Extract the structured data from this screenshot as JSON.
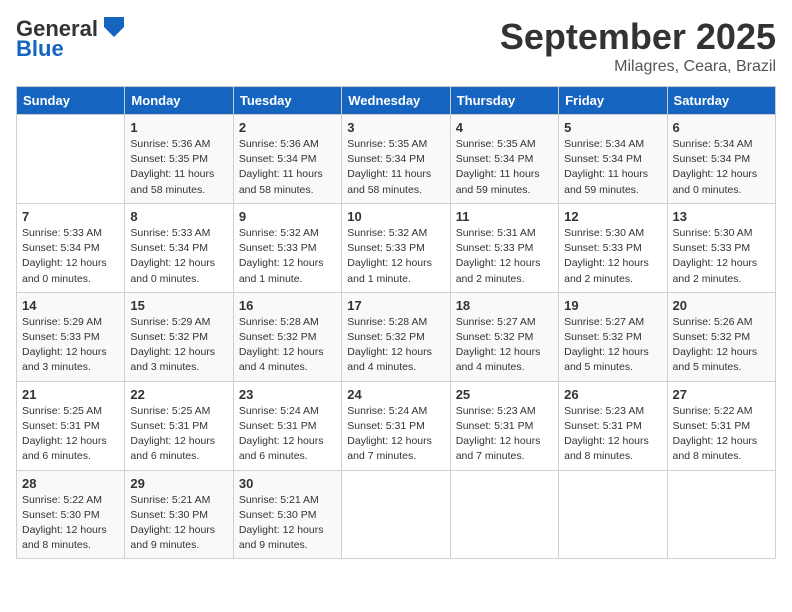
{
  "header": {
    "logo_general": "General",
    "logo_blue": "Blue",
    "month_year": "September 2025",
    "location": "Milagres, Ceara, Brazil"
  },
  "calendar": {
    "days_of_week": [
      "Sunday",
      "Monday",
      "Tuesday",
      "Wednesday",
      "Thursday",
      "Friday",
      "Saturday"
    ],
    "weeks": [
      [
        {
          "day": "",
          "info": ""
        },
        {
          "day": "1",
          "info": "Sunrise: 5:36 AM\nSunset: 5:35 PM\nDaylight: 11 hours\nand 58 minutes."
        },
        {
          "day": "2",
          "info": "Sunrise: 5:36 AM\nSunset: 5:34 PM\nDaylight: 11 hours\nand 58 minutes."
        },
        {
          "day": "3",
          "info": "Sunrise: 5:35 AM\nSunset: 5:34 PM\nDaylight: 11 hours\nand 58 minutes."
        },
        {
          "day": "4",
          "info": "Sunrise: 5:35 AM\nSunset: 5:34 PM\nDaylight: 11 hours\nand 59 minutes."
        },
        {
          "day": "5",
          "info": "Sunrise: 5:34 AM\nSunset: 5:34 PM\nDaylight: 11 hours\nand 59 minutes."
        },
        {
          "day": "6",
          "info": "Sunrise: 5:34 AM\nSunset: 5:34 PM\nDaylight: 12 hours\nand 0 minutes."
        }
      ],
      [
        {
          "day": "7",
          "info": "Sunrise: 5:33 AM\nSunset: 5:34 PM\nDaylight: 12 hours\nand 0 minutes."
        },
        {
          "day": "8",
          "info": "Sunrise: 5:33 AM\nSunset: 5:34 PM\nDaylight: 12 hours\nand 0 minutes."
        },
        {
          "day": "9",
          "info": "Sunrise: 5:32 AM\nSunset: 5:33 PM\nDaylight: 12 hours\nand 1 minute."
        },
        {
          "day": "10",
          "info": "Sunrise: 5:32 AM\nSunset: 5:33 PM\nDaylight: 12 hours\nand 1 minute."
        },
        {
          "day": "11",
          "info": "Sunrise: 5:31 AM\nSunset: 5:33 PM\nDaylight: 12 hours\nand 2 minutes."
        },
        {
          "day": "12",
          "info": "Sunrise: 5:30 AM\nSunset: 5:33 PM\nDaylight: 12 hours\nand 2 minutes."
        },
        {
          "day": "13",
          "info": "Sunrise: 5:30 AM\nSunset: 5:33 PM\nDaylight: 12 hours\nand 2 minutes."
        }
      ],
      [
        {
          "day": "14",
          "info": "Sunrise: 5:29 AM\nSunset: 5:33 PM\nDaylight: 12 hours\nand 3 minutes."
        },
        {
          "day": "15",
          "info": "Sunrise: 5:29 AM\nSunset: 5:32 PM\nDaylight: 12 hours\nand 3 minutes."
        },
        {
          "day": "16",
          "info": "Sunrise: 5:28 AM\nSunset: 5:32 PM\nDaylight: 12 hours\nand 4 minutes."
        },
        {
          "day": "17",
          "info": "Sunrise: 5:28 AM\nSunset: 5:32 PM\nDaylight: 12 hours\nand 4 minutes."
        },
        {
          "day": "18",
          "info": "Sunrise: 5:27 AM\nSunset: 5:32 PM\nDaylight: 12 hours\nand 4 minutes."
        },
        {
          "day": "19",
          "info": "Sunrise: 5:27 AM\nSunset: 5:32 PM\nDaylight: 12 hours\nand 5 minutes."
        },
        {
          "day": "20",
          "info": "Sunrise: 5:26 AM\nSunset: 5:32 PM\nDaylight: 12 hours\nand 5 minutes."
        }
      ],
      [
        {
          "day": "21",
          "info": "Sunrise: 5:25 AM\nSunset: 5:31 PM\nDaylight: 12 hours\nand 6 minutes."
        },
        {
          "day": "22",
          "info": "Sunrise: 5:25 AM\nSunset: 5:31 PM\nDaylight: 12 hours\nand 6 minutes."
        },
        {
          "day": "23",
          "info": "Sunrise: 5:24 AM\nSunset: 5:31 PM\nDaylight: 12 hours\nand 6 minutes."
        },
        {
          "day": "24",
          "info": "Sunrise: 5:24 AM\nSunset: 5:31 PM\nDaylight: 12 hours\nand 7 minutes."
        },
        {
          "day": "25",
          "info": "Sunrise: 5:23 AM\nSunset: 5:31 PM\nDaylight: 12 hours\nand 7 minutes."
        },
        {
          "day": "26",
          "info": "Sunrise: 5:23 AM\nSunset: 5:31 PM\nDaylight: 12 hours\nand 8 minutes."
        },
        {
          "day": "27",
          "info": "Sunrise: 5:22 AM\nSunset: 5:31 PM\nDaylight: 12 hours\nand 8 minutes."
        }
      ],
      [
        {
          "day": "28",
          "info": "Sunrise: 5:22 AM\nSunset: 5:30 PM\nDaylight: 12 hours\nand 8 minutes."
        },
        {
          "day": "29",
          "info": "Sunrise: 5:21 AM\nSunset: 5:30 PM\nDaylight: 12 hours\nand 9 minutes."
        },
        {
          "day": "30",
          "info": "Sunrise: 5:21 AM\nSunset: 5:30 PM\nDaylight: 12 hours\nand 9 minutes."
        },
        {
          "day": "",
          "info": ""
        },
        {
          "day": "",
          "info": ""
        },
        {
          "day": "",
          "info": ""
        },
        {
          "day": "",
          "info": ""
        }
      ]
    ]
  }
}
